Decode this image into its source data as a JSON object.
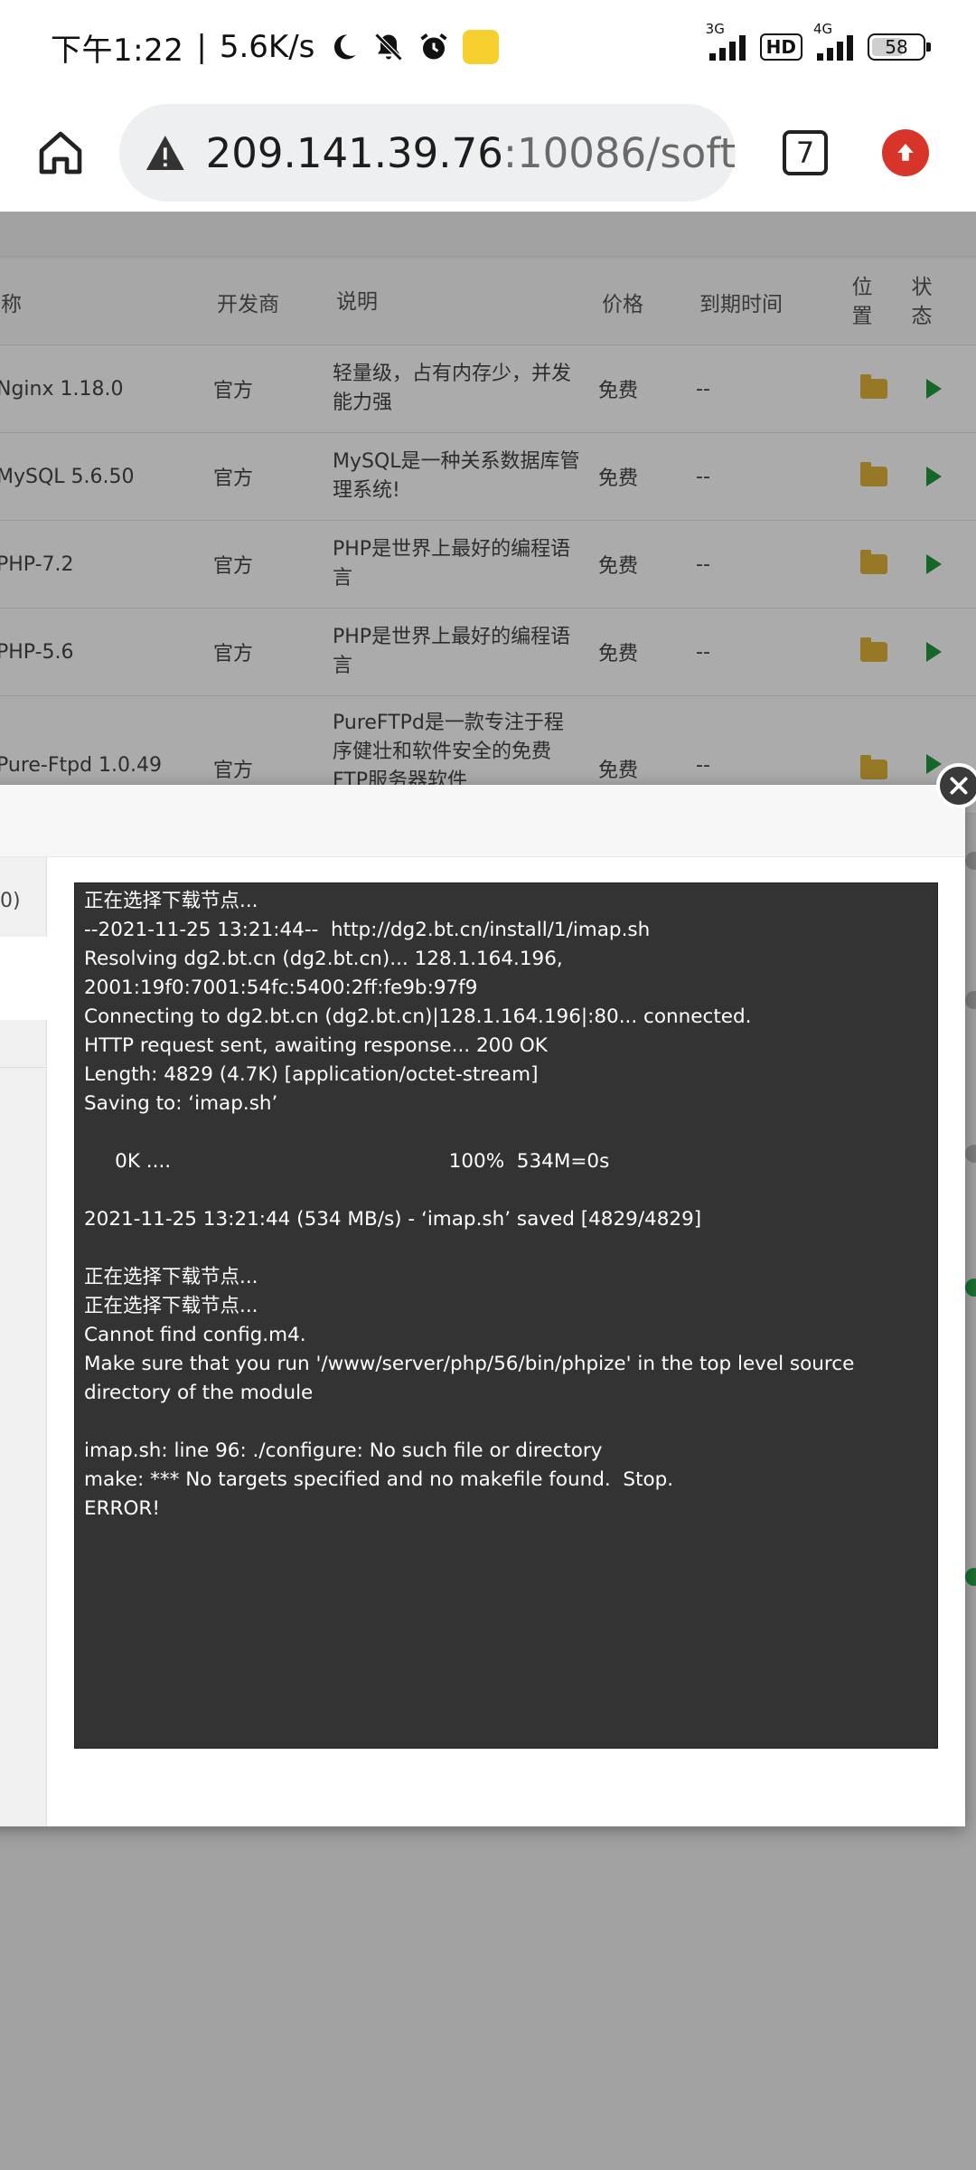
{
  "status_bar": {
    "time": "下午1:22",
    "net_speed": "5.6K/s",
    "signal1_label": "3G",
    "hd_label": "HD",
    "signal2_label": "4G",
    "battery": "58",
    "icons": [
      "moon-icon",
      "bell-off-icon",
      "alarm-icon",
      "qq-icon"
    ]
  },
  "browser": {
    "url_host": "209.141.39.76",
    "url_path": ":10086/soft",
    "tab_count": "7",
    "warning_icon": "warning-triangle-icon",
    "home_icon": "home-icon",
    "update_icon": "upload-arrow-icon"
  },
  "table": {
    "headers": {
      "name": "名称",
      "developer": "开发商",
      "description": "说明",
      "price": "价格",
      "expire": "到期时间",
      "position": "位置",
      "status": "状态"
    },
    "rows": [
      {
        "name": "Nginx 1.18.0",
        "developer": "官方",
        "description": "轻量级，占有内存少，并发能力强",
        "price": "免费",
        "expire": "--"
      },
      {
        "name": "MySQL 5.6.50",
        "developer": "官方",
        "description": "MySQL是一种关系数据库管理系统!",
        "price": "免费",
        "expire": "--"
      },
      {
        "name": "PHP-7.2",
        "developer": "官方",
        "description": "PHP是世界上最好的编程语言",
        "price": "免费",
        "expire": "--"
      },
      {
        "name": "PHP-5.6",
        "developer": "官方",
        "description": "PHP是世界上最好的编程语言",
        "price": "免费",
        "expire": "--"
      },
      {
        "name": "Pure-Ftpd 1.0.49",
        "developer": "官方",
        "description": "PureFTPd是一款专注于程序健壮和软件安全的免费FTP服务器软件",
        "price": "免费",
        "expire": "--"
      }
    ]
  },
  "modal": {
    "side_text": "0)",
    "console_lines": [
      "正在选择下载节点...",
      "--2021-11-25 13:21:44--  http://dg2.bt.cn/install/1/imap.sh",
      "Resolving dg2.bt.cn (dg2.bt.cn)... 128.1.164.196, 2001:19f0:7001:54fc:5400:2ff:fe9b:97f9",
      "Connecting to dg2.bt.cn (dg2.bt.cn)|128.1.164.196|:80... connected.",
      "HTTP request sent, awaiting response... 200 OK",
      "Length: 4829 (4.7K) [application/octet-stream]",
      "Saving to: ‘imap.sh’",
      "",
      "     0K ....                                             100%  534M=0s",
      "",
      "2021-11-25 13:21:44 (534 MB/s) - ‘imap.sh’ saved [4829/4829]",
      "",
      "正在选择下载节点...",
      "正在选择下载节点...",
      "Cannot find config.m4.",
      "Make sure that you run '/www/server/php/56/bin/phpize' in the top level source directory of the module",
      "",
      "imap.sh: line 96: ./configure: No such file or directory",
      "make: *** No targets specified and no makefile found.  Stop.",
      "ERROR!"
    ]
  },
  "colors": {
    "console_bg": "#333333",
    "play_green": "#1f9a3c",
    "folder_yellow": "#e0b33a",
    "update_red": "#d8352a"
  }
}
